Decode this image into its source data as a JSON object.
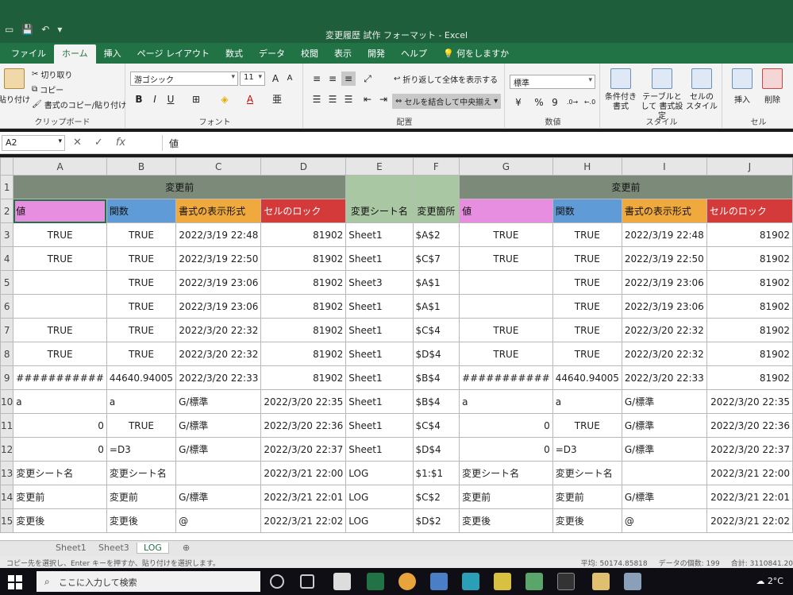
{
  "window": {
    "title": "変更履歴 試作 フォーマット - Excel"
  },
  "tabs": [
    "ファイル",
    "ホーム",
    "挿入",
    "ページ レイアウト",
    "数式",
    "データ",
    "校閲",
    "表示",
    "開発",
    "ヘルプ",
    "何をしますか"
  ],
  "active_tab": "ホーム",
  "ribbon": {
    "clipboard": {
      "paste": "貼り付け",
      "cut": "切り取り",
      "copy": "コピー",
      "format_painter": "書式のコピー/貼り付け",
      "label": "クリップボード"
    },
    "font": {
      "name": "游ゴシック",
      "size": "11",
      "bold": "B",
      "italic": "I",
      "underline": "U",
      "label": "フォント"
    },
    "alignment": {
      "wrap": "折り返して全体を表示する",
      "merge": "セルを結合して中央揃え",
      "label": "配置"
    },
    "number": {
      "format": "標準",
      "percent": "%",
      "comma": "9",
      "label": "数値"
    },
    "styles": {
      "conditional": "条件付き 書式",
      "table": "テーブルとして 書式設定",
      "cell": "セルの スタイル",
      "label": "スタイル"
    },
    "cells": {
      "insert": "挿入",
      "delete": "削除",
      "label": "セル"
    }
  },
  "formula_bar": {
    "name_box": "A2",
    "value": "値"
  },
  "grid": {
    "columns": [
      "A",
      "B",
      "C",
      "D",
      "E",
      "F",
      "G",
      "H",
      "I",
      "J"
    ],
    "row1": {
      "left_group": "変更前",
      "right_group": "変更前"
    },
    "row2": [
      "値",
      "関数",
      "書式の表示形式",
      "セルのロック",
      "変更シート名",
      "変更箇所",
      "値",
      "関数",
      "書式の表示形式",
      "セルのロック"
    ],
    "rows": [
      [
        "3",
        "TRUE",
        "TRUE",
        "2022/3/19 22:48",
        "81902",
        "Sheet1",
        "$A$2",
        "TRUE",
        "TRUE",
        "2022/3/19 22:48",
        "81902"
      ],
      [
        "4",
        "TRUE",
        "TRUE",
        "2022/3/19 22:50",
        "81902",
        "Sheet1",
        "$C$7",
        "TRUE",
        "TRUE",
        "2022/3/19 22:50",
        "81902"
      ],
      [
        "5",
        "",
        "TRUE",
        "2022/3/19 23:06",
        "81902",
        "Sheet3",
        "$A$1",
        "",
        "TRUE",
        "2022/3/19 23:06",
        "81902"
      ],
      [
        "6",
        "",
        "TRUE",
        "2022/3/19 23:06",
        "81902",
        "Sheet1",
        "$A$1",
        "",
        "TRUE",
        "2022/3/19 23:06",
        "81902"
      ],
      [
        "7",
        "TRUE",
        "TRUE",
        "2022/3/20 22:32",
        "81902",
        "Sheet1",
        "$C$4",
        "TRUE",
        "TRUE",
        "2022/3/20 22:32",
        "81902"
      ],
      [
        "8",
        "TRUE",
        "TRUE",
        "2022/3/20 22:32",
        "81902",
        "Sheet1",
        "$D$4",
        "TRUE",
        "TRUE",
        "2022/3/20 22:32",
        "81902"
      ],
      [
        "9",
        "###########",
        "44640.94005",
        "2022/3/20 22:33",
        "81902",
        "Sheet1",
        "$B$4",
        "###########",
        "44640.94005",
        "2022/3/20 22:33",
        "81902"
      ],
      [
        "10",
        "a",
        "a",
        "G/標準",
        "2022/3/20 22:35",
        "Sheet1",
        "$B$4",
        "a",
        "a",
        "G/標準",
        "2022/3/20 22:35"
      ],
      [
        "11",
        "0",
        "TRUE",
        "G/標準",
        "2022/3/20 22:36",
        "Sheet1",
        "$C$4",
        "0",
        "TRUE",
        "G/標準",
        "2022/3/20 22:36"
      ],
      [
        "12",
        "0",
        "=D3",
        "G/標準",
        "2022/3/20 22:37",
        "Sheet1",
        "$D$4",
        "0",
        "=D3",
        "G/標準",
        "2022/3/20 22:37"
      ],
      [
        "13",
        "変更シート名",
        "変更シート名",
        "",
        "2022/3/21 22:00",
        "LOG",
        "$1:$1",
        "変更シート名",
        "変更シート名",
        "",
        "2022/3/21 22:00"
      ],
      [
        "14",
        "変更前",
        "変更前",
        "G/標準",
        "2022/3/21 22:01",
        "LOG",
        "$C$2",
        "変更前",
        "変更前",
        "G/標準",
        "2022/3/21 22:01"
      ],
      [
        "15",
        "変更後",
        "変更後",
        "@",
        "2022/3/21 22:02",
        "LOG",
        "$D$2",
        "変更後",
        "変更後",
        "@",
        "2022/3/21 22:02"
      ]
    ]
  },
  "sheet_tabs": [
    "Sheet1",
    "Sheet3",
    "LOG"
  ],
  "active_sheet": "LOG",
  "status": {
    "message": "コピー先を選択し、Enter キーを押すか、貼り付けを選択します。",
    "average": "平均: 50174.85818",
    "count": "データの個数: 199",
    "sum": "合計: 3110841.20"
  },
  "taskbar": {
    "search_placeholder": "ここに入力して検索",
    "weather": "2°C"
  }
}
